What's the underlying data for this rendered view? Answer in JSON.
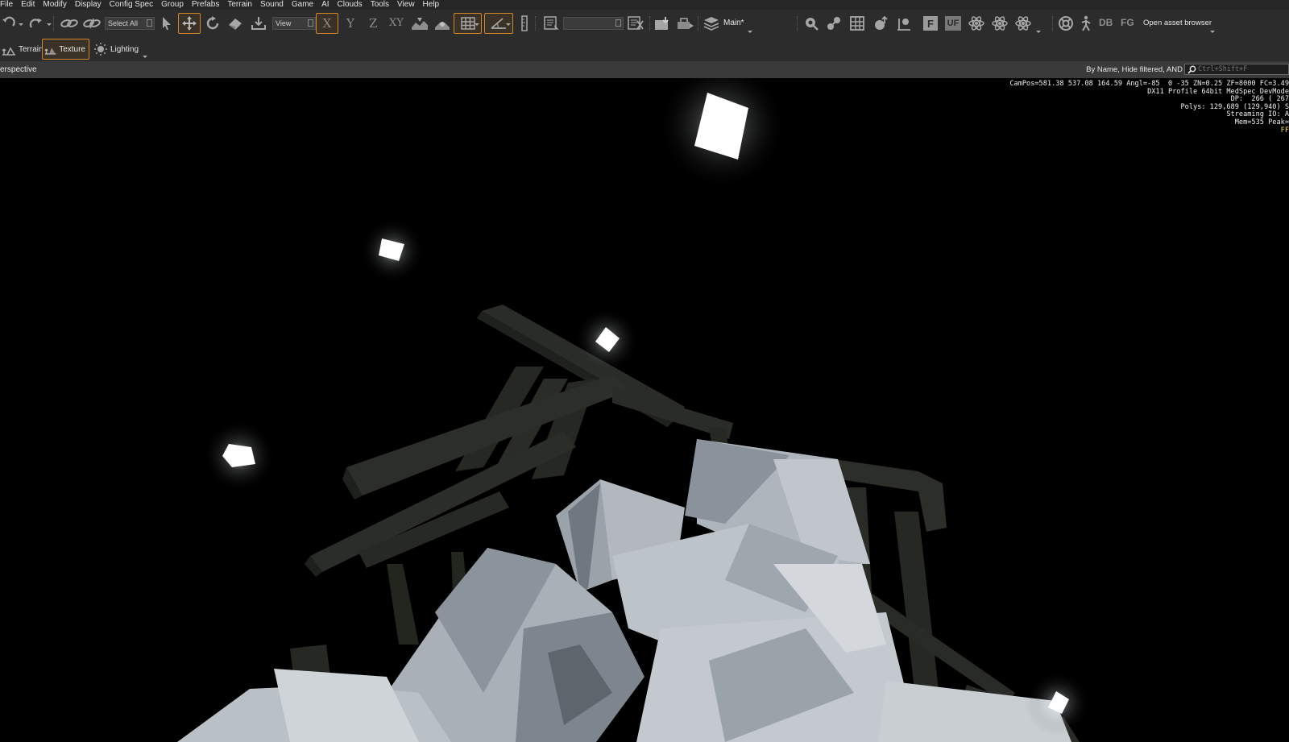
{
  "menu": [
    "File",
    "Edit",
    "Modify",
    "Display",
    "Config Spec",
    "Group",
    "Prefabs",
    "Terrain",
    "Sound",
    "Game",
    "AI",
    "Clouds",
    "Tools",
    "View",
    "Help"
  ],
  "toolbar": {
    "select_all": "Select All",
    "coord_system": "View",
    "axes": {
      "x": "X",
      "y": "Y",
      "z": "Z",
      "xy": "XY"
    },
    "layer": "Main*",
    "text_buttons": {
      "f": "F",
      "uf": "UF",
      "db": "DB",
      "fg": "FG"
    },
    "open_asset_browser": "Open asset browser",
    "accent_color": "#d1862b"
  },
  "edit_modes": [
    {
      "label": "Terrain",
      "icon": "terrain-icon",
      "active": false
    },
    {
      "label": "Texture",
      "icon": "texture-icon",
      "active": true
    },
    {
      "label": "Lighting",
      "icon": "sun-icon",
      "active": false
    }
  ],
  "viewport": {
    "name": "erspective",
    "filter_text": "By Name, Hide filtered, AND",
    "search_placeholder": "Ctrl+Shift+F",
    "stats": {
      "line1": "CamPos=581.38 537.08 164.59 Angl=-85  0 -35 ZN=0.25 ZF=8000 FC=3.49",
      "line2": "DX11 Profile 64bit MedSpec DevMode",
      "line3": "DP:  266 ( 267",
      "line4": "Polys: 129,689 (129,940) S",
      "line5": "Streaming IO: A",
      "line6": "Mem=535 Peak=",
      "line7": "FF"
    }
  }
}
